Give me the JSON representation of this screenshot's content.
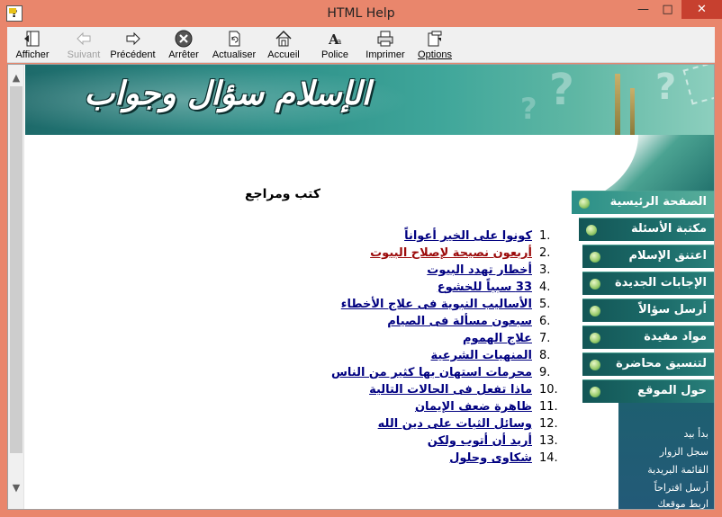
{
  "window": {
    "title": "HTML Help",
    "app_icon": "help-icon"
  },
  "toolbar": {
    "buttons": [
      {
        "label": "Afficher",
        "icon": "show-pane-icon",
        "enabled": true
      },
      {
        "label": "Suivant",
        "icon": "back-arrow-icon",
        "enabled": false
      },
      {
        "label": "Précédent",
        "icon": "forward-arrow-icon",
        "enabled": true
      },
      {
        "label": "Arrêter",
        "icon": "stop-icon",
        "enabled": true
      },
      {
        "label": "Actualiser",
        "icon": "refresh-icon",
        "enabled": true
      },
      {
        "label": "Accueil",
        "icon": "home-icon",
        "enabled": true
      },
      {
        "label": "Police",
        "icon": "font-icon",
        "enabled": true
      },
      {
        "label": "Imprimer",
        "icon": "printer-icon",
        "enabled": true
      },
      {
        "label": "Options",
        "icon": "options-icon",
        "enabled": true
      }
    ]
  },
  "banner": {
    "title": "الإسلام سؤال وجواب"
  },
  "main": {
    "page_title": "كتب ومراجع",
    "items": [
      {
        "num": "1.",
        "label": "كونوا على الخير أعواناً",
        "visited": false
      },
      {
        "num": "2.",
        "label": "أربعون نصيحة لإصلاح البيوت",
        "visited": true
      },
      {
        "num": "3.",
        "label": "أخطار تهدد البيوت",
        "visited": false
      },
      {
        "num": "4.",
        "label": "33 سبباً للخشوع",
        "visited": false
      },
      {
        "num": "5.",
        "label": "الأساليب النبوية فى علاج الأخطاء",
        "visited": false
      },
      {
        "num": "6.",
        "label": "سبعون مسألة فى الصيام",
        "visited": false
      },
      {
        "num": "7.",
        "label": "علاج الهموم",
        "visited": false
      },
      {
        "num": "8.",
        "label": "المنهيات الشرعية",
        "visited": false
      },
      {
        "num": "9.",
        "label": "محرمات استهان بها كثير من الناس",
        "visited": false
      },
      {
        "num": "10.",
        "label": "ماذا تفعل فى الحالات التالية",
        "visited": false
      },
      {
        "num": "11.",
        "label": "ظاهرة ضعف الإيمان",
        "visited": false
      },
      {
        "num": "12.",
        "label": "وسائل الثبات على دين الله",
        "visited": false
      },
      {
        "num": "13.",
        "label": "أريد أن أتوب ولكن",
        "visited": false
      },
      {
        "num": "14.",
        "label": "شكاوى وحلول",
        "visited": false
      }
    ]
  },
  "nav": {
    "items": [
      "الصفحة الرئيسية",
      "مكتبة الأسئلة",
      "اعتنق الإسلام",
      "الإجابات الجديدة",
      "أرسل سؤالاً",
      "مواد مفيدة",
      "لتنسيق محاضرة",
      "حول الموقع"
    ]
  },
  "footer_links": [
    "بدأ بيد",
    "سجل الزوار",
    "القائمة البريدية",
    "أرسل اقتراحاً",
    "اربط موقعك"
  ]
}
